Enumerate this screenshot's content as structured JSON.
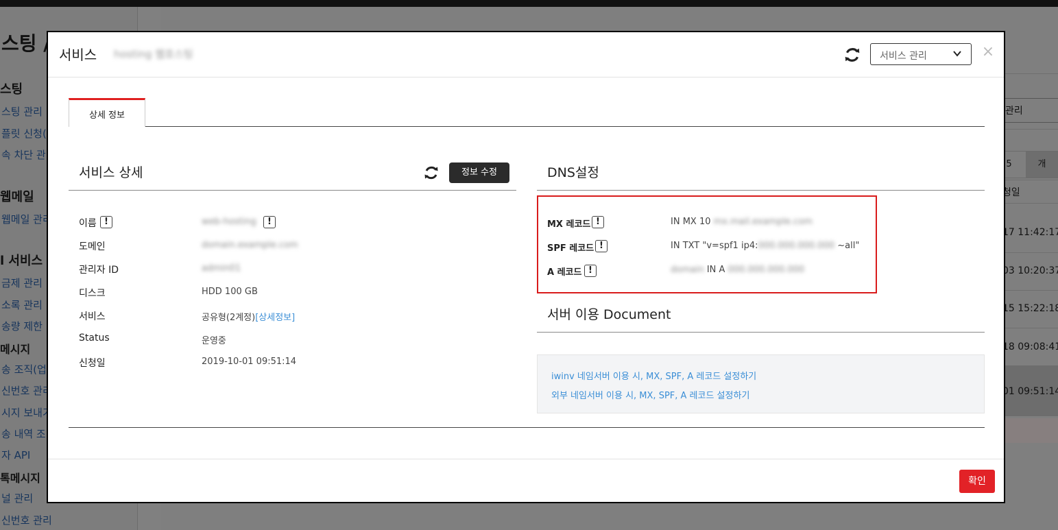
{
  "background": {
    "page_title": "스팅 /",
    "sidebar": [
      {
        "type": "head",
        "text": "스팅"
      },
      {
        "type": "item",
        "text": "스팅 관리"
      },
      {
        "type": "item",
        "text": "플릿 신청("
      },
      {
        "type": "item",
        "text": "속 차단 관리"
      },
      {
        "type": "head",
        "text": "웹메일"
      },
      {
        "type": "item",
        "text": "웹메일 관리"
      },
      {
        "type": "head",
        "text": "l 서비스"
      },
      {
        "type": "item",
        "text": "금제 관리"
      },
      {
        "type": "item",
        "text": "소록 관리"
      },
      {
        "type": "item",
        "text": "송량 제한"
      },
      {
        "type": "head",
        "text": "메시지"
      },
      {
        "type": "item",
        "text": "송 조직(업"
      },
      {
        "type": "item",
        "text": "신번호 관리"
      },
      {
        "type": "item",
        "text": "시지 보내기"
      },
      {
        "type": "item",
        "text": "송 내역 조"
      },
      {
        "type": "item",
        "text": "자 API"
      },
      {
        "type": "head",
        "text": "톡메시지"
      },
      {
        "type": "item",
        "text": "널 관리"
      },
      {
        "type": "item",
        "text": "신번호 관리"
      }
    ],
    "select_text": "관리",
    "pager": [
      "5",
      "개"
    ],
    "col_header": "청일",
    "times": [
      "17 11:42:17",
      "03 10:20:37",
      "15 15:22:18",
      "18 09:08:41",
      "01 09:51:14"
    ]
  },
  "modal": {
    "title": "서비스",
    "subtitle": "hosting 웹호스팅",
    "header_select": "서비스 관리",
    "close": "×",
    "tab": "상세 정보",
    "confirm": "확인"
  },
  "service_detail": {
    "title": "서비스 상세",
    "edit_button": "정보 수정",
    "rows": [
      {
        "label": "이름",
        "value": "web-hosting",
        "excl": true,
        "value_excl": true,
        "blur": true
      },
      {
        "label": "도메인",
        "value": "domain.example.com",
        "blur": true
      },
      {
        "label": "관리자 ID",
        "value": "admin01",
        "blur": true
      },
      {
        "label": "디스크",
        "value": "HDD 100 GB"
      },
      {
        "label": "서비스",
        "value": "공유형(2계정)",
        "link": "[상세정보]"
      },
      {
        "label": "Status",
        "value": "운영중"
      },
      {
        "label": "신청일",
        "value": "2019-10-01 09:51:14"
      }
    ]
  },
  "dns": {
    "title": "DNS설정",
    "records": [
      {
        "label": "MX 레코드",
        "prefix": "IN MX 10 ",
        "hidden": "mx.mail.example.com",
        "suffix": ""
      },
      {
        "label": "SPF 레코드",
        "prefix": "IN TXT \"v=spf1 ip4:",
        "hidden": "000.000.000.000",
        "suffix": " ~all\""
      },
      {
        "label": "A 레코드",
        "prefix": "",
        "hidden": "domain",
        "middle": " IN A ",
        "hidden2": "000.000.000.000",
        "suffix": ""
      }
    ]
  },
  "document": {
    "title": "서버 이용 Document",
    "links": [
      "iwinv 네임서버 이용 시, MX, SPF, A 레코드 설정하기",
      "외부 네임서버 이용 시, MX, SPF, A 레코드 설정하기"
    ]
  }
}
